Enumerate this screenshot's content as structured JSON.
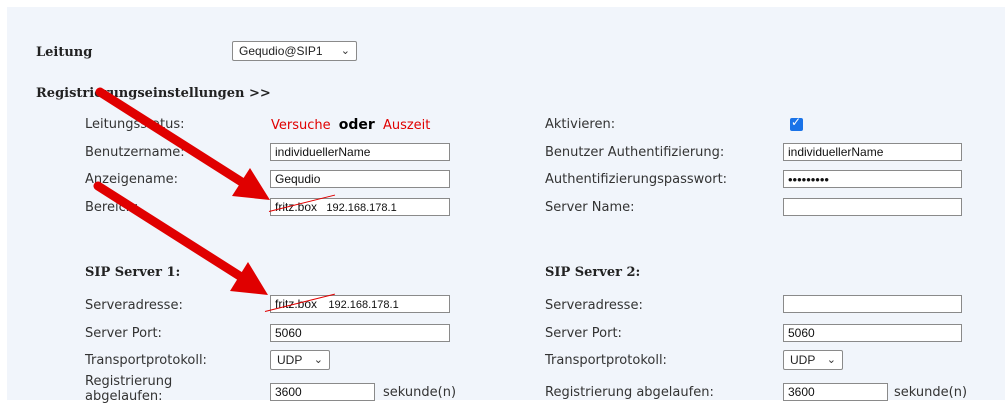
{
  "line": {
    "label": "Leitung",
    "value": "Gequdio@SIP1"
  },
  "section_link": "Registrierungseinstellungen >>",
  "left": {
    "status_label": "Leitungsstatus:",
    "status_value_1": "Versuche",
    "status_word": "oder",
    "status_value_2": "Auszeit",
    "username_label": "Benutzername:",
    "username_value": "individuellerName",
    "display_label": "Anzeigename:",
    "display_value": "Gequdio",
    "realm_label": "Bereich:",
    "realm_struck": "fritz.box",
    "realm_new": "192.168.178.1"
  },
  "right": {
    "activate_label": "Aktivieren:",
    "auth_user_label": "Benutzer Authentifizierung:",
    "auth_user_value": "individuellerName",
    "auth_pass_label": "Authentifizierungspasswort:",
    "auth_pass_value": "•••••••••",
    "server_name_label": "Server Name:",
    "server_name_value": ""
  },
  "sip1": {
    "title": "SIP Server 1:",
    "address_label": "Serveradresse:",
    "address_struck": "fritz.box",
    "address_new": "192.168.178.1",
    "port_label": "Server Port:",
    "port_value": "5060",
    "transport_label": "Transportprotokoll:",
    "transport_value": "UDP",
    "expiry_label": "Registrierung abgelaufen:",
    "expiry_value": "3600",
    "expiry_unit": "sekunde(n)"
  },
  "sip2": {
    "title": "SIP Server 2:",
    "address_label": "Serveradresse:",
    "address_value": "",
    "port_label": "Server Port:",
    "port_value": "5060",
    "transport_label": "Transportprotokoll:",
    "transport_value": "UDP",
    "expiry_label": "Registrierung abgelaufen:",
    "expiry_value": "3600",
    "expiry_unit": "sekunde(n)"
  },
  "colors": {
    "accent_red": "#e00000",
    "checkbox_blue": "#1a73e8",
    "panel_bg": "#f1f5fb"
  }
}
